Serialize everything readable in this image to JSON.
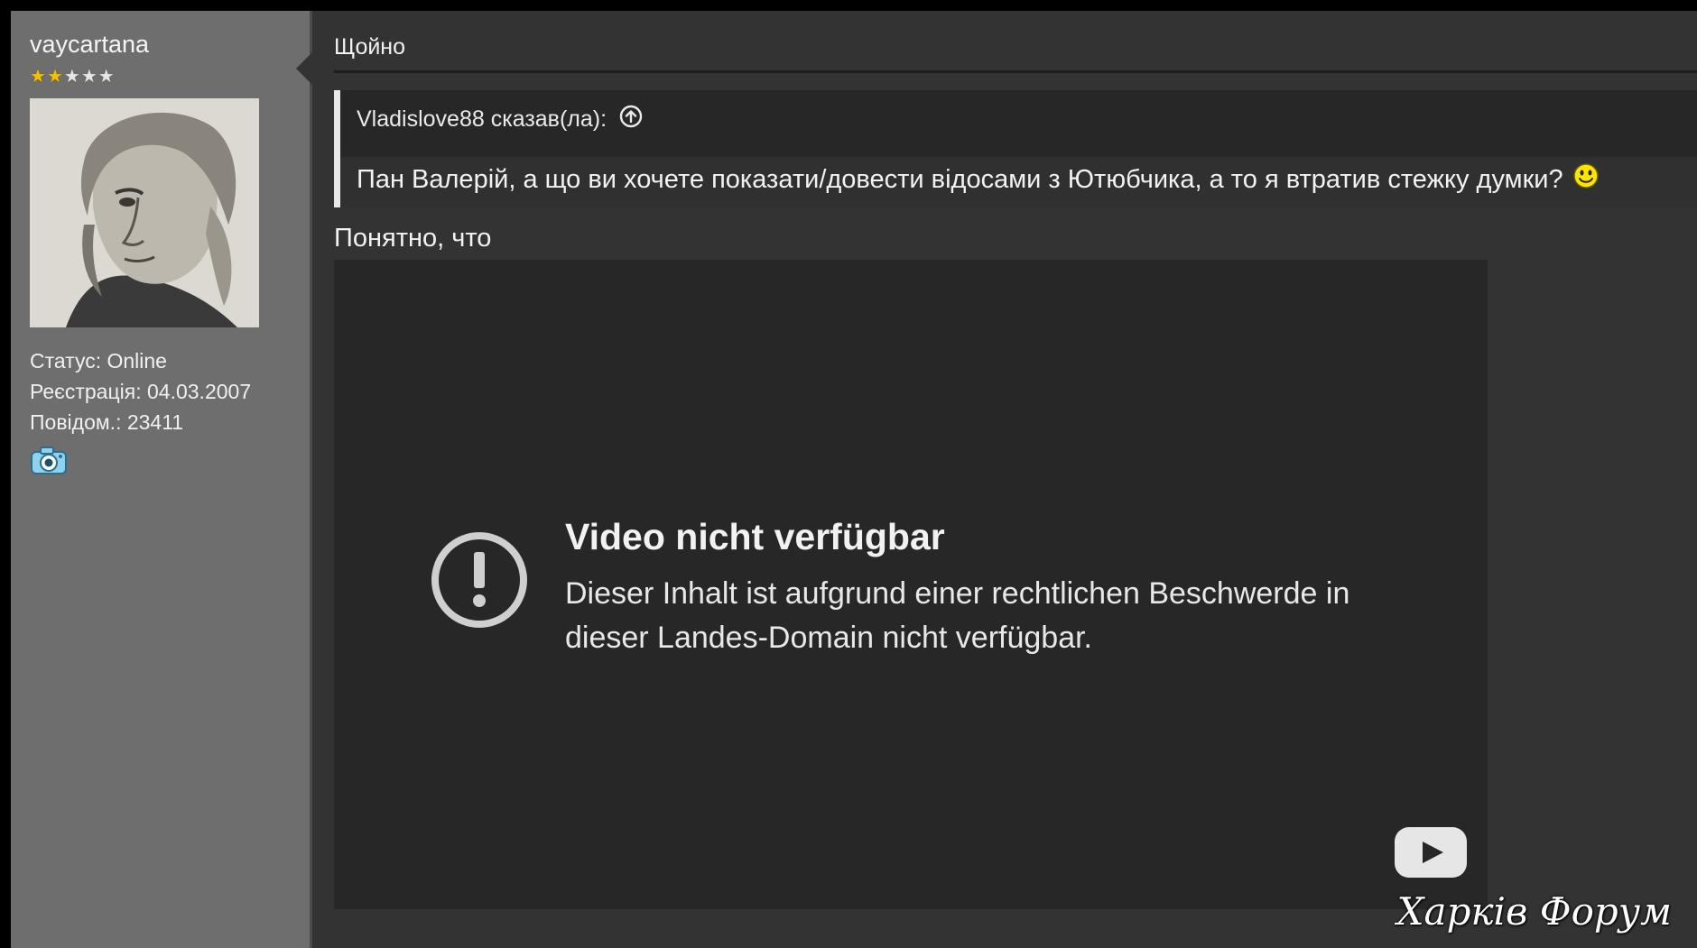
{
  "profile": {
    "username": "vaycartana",
    "rating_stars": 5,
    "rating_filled": 2,
    "status": "Статус: Online",
    "registered": "Реєстрація: 04.03.2007",
    "posts": "Повідом.: 23411",
    "contact_icon": "camera-icon"
  },
  "post": {
    "time": "Щойно",
    "quote": {
      "author": "Vladislove88 сказав(ла):",
      "jump_icon": "arrow-up-circle-icon",
      "text": "Пан Валерій, а що ви хочете показати/довести відосами з Ютюбчика, а то я втратив стежку думки?",
      "emoji": "smiley-icon"
    },
    "text": "Понятно, что",
    "video": {
      "title": "Video nicht verfügbar",
      "message": "Dieser Inhalt ist aufgrund einer rechtlichen Beschwerde in dieser Landes-Domain nicht verfügbar.",
      "icon": "warning-circle-icon",
      "logo": "youtube-logo-icon"
    }
  },
  "watermark": "Харків Форум",
  "colors": {
    "sidebar_bg": "#6e6e6e",
    "content_bg": "#333333",
    "quote_bg": "#272727",
    "star_gold": "#f2c200"
  }
}
